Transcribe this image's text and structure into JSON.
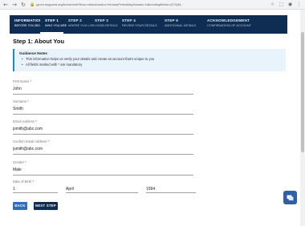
{
  "browser": {
    "url": "ypom.myguest.org/home/visit?flow=visitor/cacitor-HenseyPeriodicity/bosset=1#bundlegift#dw=QTIQM..."
  },
  "steps": [
    {
      "title": "INFORMATION",
      "sub": "BEFORE YOU BEGIN"
    },
    {
      "title": "STEP 1",
      "sub": "WHO YOU ARE"
    },
    {
      "title": "STEP 2",
      "sub": "WHERE YOU LIVE"
    },
    {
      "title": "STEP 3",
      "sub": "LOGIN DETAILS"
    },
    {
      "title": "STEP 4",
      "sub": "REVIEW YOUR DETAILS"
    },
    {
      "title": "STEP 5",
      "sub": "ADDITIONAL DETAILS"
    },
    {
      "title": "ACKNOWLEDGEMENT",
      "sub": "CONFIRMATION OF ACCOUNT"
    }
  ],
  "active_step": 1,
  "page_title": "Step 1: About You",
  "guidance": {
    "title": "Guidance Notes",
    "items": [
      "This information helps us verify your details and create an account that's unique to you",
      "All fields marked with * are mandatory"
    ]
  },
  "fields": {
    "first_name": {
      "label": "First Name",
      "value": "John"
    },
    "surname": {
      "label": "Surname",
      "value": "Smith"
    },
    "email": {
      "label": "Email Address",
      "value": "jsmith@abc.com"
    },
    "confirm_email": {
      "label": "Confirm Email Address",
      "value": "jsmith@abc.com"
    },
    "gender": {
      "label": "Gender",
      "value": "Male"
    },
    "dob": {
      "label": "Date of Birth",
      "day": "1",
      "month": "April",
      "year": "1994"
    }
  },
  "required_mark": "*",
  "buttons": {
    "back": "BACK",
    "next": "NEXT STEP"
  },
  "colors": {
    "nav_bg": "#0f2d52",
    "accent": "#1c88d8",
    "back_button": "#2f6fba",
    "chat_widget": "#2f5fa7"
  }
}
